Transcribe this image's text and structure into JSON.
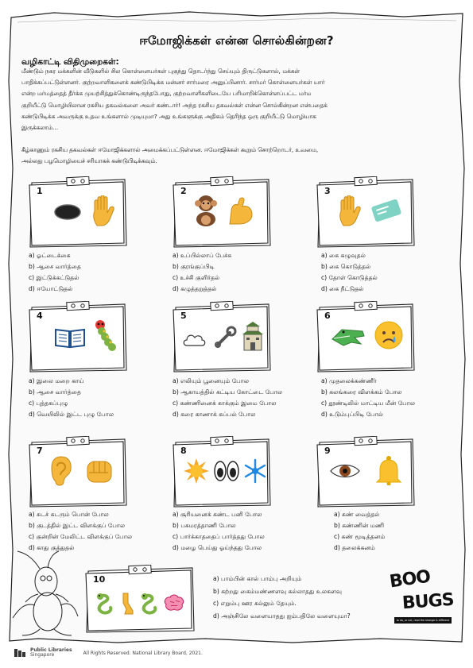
{
  "title": "ஈமோஜிக்கள் என்ன சொல்கின்றன?",
  "instructions_heading": "வழிகாட்டி விதிமுறைகள்:",
  "story_lines": [
    "மீண்டும் நகர மக்களின் வீடுகளில் சில கொள்ளையர்கள் புகுந்து தொடர்ந்து செய்யும் திருட்டுகளால், மக்கள்",
    "பாதிக்கப்பட்டுள்ளனர். குற்றவாளிகளைக் கண்டுபிடிக்க மன்னர் சார்மரை அனுப்பினார். சார்மர் கொள்ளையர்கள் யார்",
    "என்ற மர்மத்தைத் தீர்க்க முயற்சித்துக்கொண்டிருந்தபோது, குற்றவாளிகளிடையே பரிமாறிக்கொள்ளப்பட்ட மர்ம",
    "குறியீட்டு மொழியிலான ரகசிய தகவல்களை அவர் கண்டார்! அந்த ரகசிய தகவல்கள் என்ன சொல்கின்றன என்பதைக்",
    "கண்டுபிடிக்க அவருக்கு உதவ உங்களால் முடியுமா? அது உங்களுக்கு அதிகம் தெரிந்த ஒரு குறியீட்டு மொழியாக",
    "இருக்கலாம்…"
  ],
  "task_lines": [
    "கீழ்காணும் ரகசிய தகவல்கள் ஈமோஜிக்களால் அமைக்கப்பட்டுள்ளன. ஈமோஜிக்கள் கூறும் சொற்றொடர், உவமை,",
    "அல்லது பழமொழியைச் சரியாகக் கண்டுபிடிக்கவும்."
  ],
  "puzzles": [
    {
      "number": "1",
      "emojis": [
        "black-hole-emoji",
        "raised-hand-emoji"
      ],
      "options": [
        "a) ஓட்டைக்கை",
        "b) ஆசை வார்த்தை",
        "c) இட்டுக்கட்டுதல்",
        "d) ஈயோட்டுதல்"
      ]
    },
    {
      "number": "2",
      "emojis": [
        "monkey-emoji",
        "flexed-biceps-emoji"
      ],
      "options": [
        "a) உப்பில்லாப் பேச்சு",
        "b) குரங்குப்பிடி",
        "c) உச்சி குளிர்தல்",
        "d) கழுத்தறுத்தல்"
      ]
    },
    {
      "number": "3",
      "emojis": [
        "raised-hand-emoji",
        "ticket-emoji"
      ],
      "options": [
        "a) கை கழுவுதல்",
        "b) கை கொடுத்தல்",
        "c) தோள் கொடுத்தல்",
        "d) கை நீட்டுதல்"
      ]
    },
    {
      "number": "4",
      "emojis": [
        "open-book-emoji",
        "bug-emoji"
      ],
      "options": [
        "a) இலை மறை காய்",
        "b) ஆசை வார்த்தை",
        "c) புத்தகப்புழு",
        "d) வெயிலில் இட்ட புழு போல"
      ]
    },
    {
      "number": "5",
      "emojis": [
        "cloud-emoji",
        "wrench-emoji",
        "castle-emoji"
      ],
      "options": [
        "a) எலியும் பூனையும் போல",
        "b) ஆகாயத்தில் கட்டிய கோட்டை போல",
        "c) கண்ணினைக் காக்கும் இமை போல",
        "d) கரை காணாக் கப்பல் போல"
      ]
    },
    {
      "number": "6",
      "emojis": [
        "crocodile-emoji",
        "crying-face-emoji"
      ],
      "options": [
        "a) முதலைக்கண்ணீர்",
        "b) கலங்கரை விளக்கம் போல",
        "c) தூண்டிலில் மாட்டிய மீன் போல",
        "d) உடும்புப்பிடி போல்"
      ]
    },
    {
      "number": "7",
      "emojis": [
        "ear-emoji",
        "oncoming-fist-emoji"
      ],
      "options": [
        "a) சுடச் சுடரும் பொன் போல",
        "b) குடத்தில் இட்ட விளக்குப் போல",
        "c) குன்றின் மேலிட்ட விளக்குப் போல",
        "d) காது குத்துதல்"
      ]
    },
    {
      "number": "8",
      "emojis": [
        "sun-emoji",
        "eyes-emoji",
        "snowflake-emoji"
      ],
      "options": [
        "a) சூரியனைக் கண்ட பனி போல",
        "b) பசுமரத்தாணி போல",
        "c) பார்க்காததைப் பார்த்தது போல",
        "d) மழை பெய்து ஓய்ந்தது போல"
      ]
    },
    {
      "number": "9",
      "emojis": [
        "eye-emoji",
        "bell-emoji"
      ],
      "options": [
        "a) கண் வைத்தல்",
        "b) கண்ணின் மணி",
        "c) கண் மூடித்தனம்",
        "d) தலைக்கனம்"
      ]
    },
    {
      "number": "10",
      "emojis": [
        "snake-emoji",
        "leg-emoji",
        "snake-emoji",
        "brain-emoji"
      ],
      "options": [
        "a) பாம்பின் கால் பாம்பு அறியும்",
        "b) கற்றது கைம்மண்ணளவு கல்லாதது உலகளவு",
        "c) எறும்பு ஊர கல்லும் தேயும்.",
        "d) அஞ்சிலே வளையாதது ஐம்பதிலே வளையுமா?"
      ]
    }
  ],
  "logo": {
    "line1": "BOO",
    "line2": "BUGS",
    "tagline": "to do, or not, read the strange & different"
  },
  "footer": {
    "org_line1": "Public Libraries",
    "org_line2": "Singapore",
    "copyright": "All Rights Reserved. National Library Board, 2021."
  }
}
